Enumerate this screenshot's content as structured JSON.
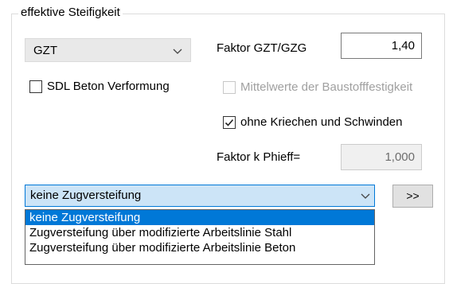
{
  "group": {
    "title": "effektive Steifigkeit"
  },
  "limit_state_combo": {
    "value": "GZT"
  },
  "factor_gzt_gzg": {
    "label": "Faktor GZT/GZG",
    "value": "1,40"
  },
  "sdl_beton": {
    "label": "SDL Beton Verformung",
    "checked": false
  },
  "mittelwerte": {
    "label": "Mittelwerte der Baustofffestigkeit",
    "checked": false,
    "enabled": false
  },
  "ohne_kriechen": {
    "label": "ohne Kriechen und Schwinden",
    "checked": true
  },
  "factor_kphi": {
    "label": "Faktor k Phieff=",
    "value": "1,000",
    "enabled": false
  },
  "zug_combo": {
    "value": "keine Zugversteifung",
    "options": [
      "keine Zugversteifung",
      "Zugversteifung über modifizierte Arbeitslinie Stahl",
      "Zugversteifung über modifizierte Arbeitslinie Beton"
    ],
    "selected_index": 0
  },
  "more_button": {
    "label": ">>"
  }
}
